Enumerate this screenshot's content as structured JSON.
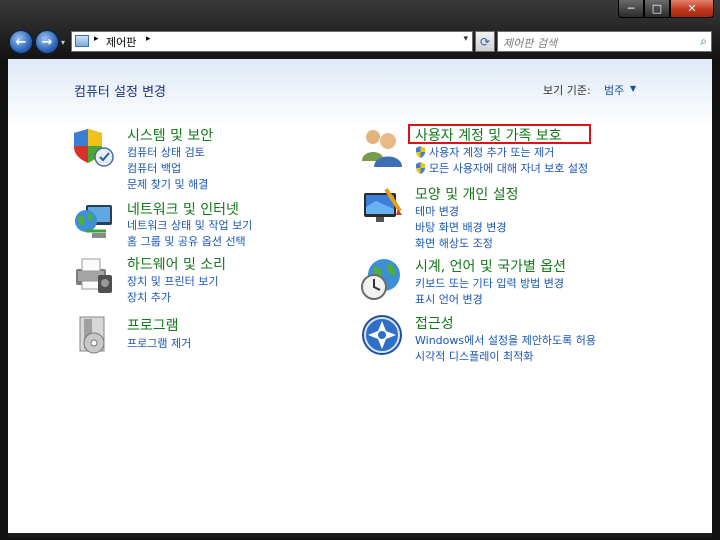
{
  "window": {
    "minimize_glyph": "─",
    "maximize_glyph": "□",
    "close_glyph": "✕"
  },
  "nav": {
    "back_glyph": "←",
    "forward_glyph": "→",
    "address_sep": "▸",
    "breadcrumb": "제어판",
    "dropdown_glyph": "▾",
    "refresh_glyph": "⟳",
    "search_placeholder": "제어판 검색",
    "search_glyph": "⌕"
  },
  "content": {
    "heading": "컴퓨터 설정 변경",
    "view_by_label": "보기 기준:",
    "view_by_value": "범주",
    "view_by_arrow": "▼"
  },
  "categories": {
    "system": {
      "title": "시스템 및 보안",
      "links": [
        "컴퓨터 상태 검토",
        "컴퓨터 백업",
        "문제 찾기 및 해결"
      ],
      "icon": "shield-check-icon"
    },
    "network": {
      "title": "네트워크 및 인터넷",
      "links": [
        "네트워크 상태 및 작업 보기",
        "홈 그룹 및 공유 옵션 선택"
      ],
      "icon": "network-globe-icon"
    },
    "hardware": {
      "title": "하드웨어 및 소리",
      "links": [
        "장치 및 프린터 보기",
        "장치 추가"
      ],
      "icon": "printer-icon"
    },
    "programs": {
      "title": "프로그램",
      "links": [
        "프로그램 제거"
      ],
      "icon": "program-box-icon"
    },
    "users": {
      "title": "사용자 계정 및 가족 보호",
      "links": [
        "사용자 계정 추가 또는 제거",
        "모든 사용자에 대해 자녀 보호 설정"
      ],
      "icon": "users-icon"
    },
    "appearance": {
      "title": "모양 및 개인 설정",
      "links": [
        "테마 변경",
        "바탕 화면 배경 변경",
        "화면 해상도 조정"
      ],
      "icon": "monitor-paint-icon"
    },
    "clock": {
      "title": "시계, 언어 및 국가별 옵션",
      "links": [
        "키보드 또는 기타 입력 방법 변경",
        "표시 언어 변경"
      ],
      "icon": "clock-globe-icon"
    },
    "access": {
      "title": "접근성",
      "links": [
        "Windows에서 설정을 제안하도록 허용",
        "시각적 디스플레이 최적화"
      ],
      "icon": "ease-of-access-icon"
    }
  },
  "colors": {
    "category_title": "#13781a",
    "link": "#1a56b5",
    "heading": "#1e3287",
    "highlight": "#e0101a"
  }
}
